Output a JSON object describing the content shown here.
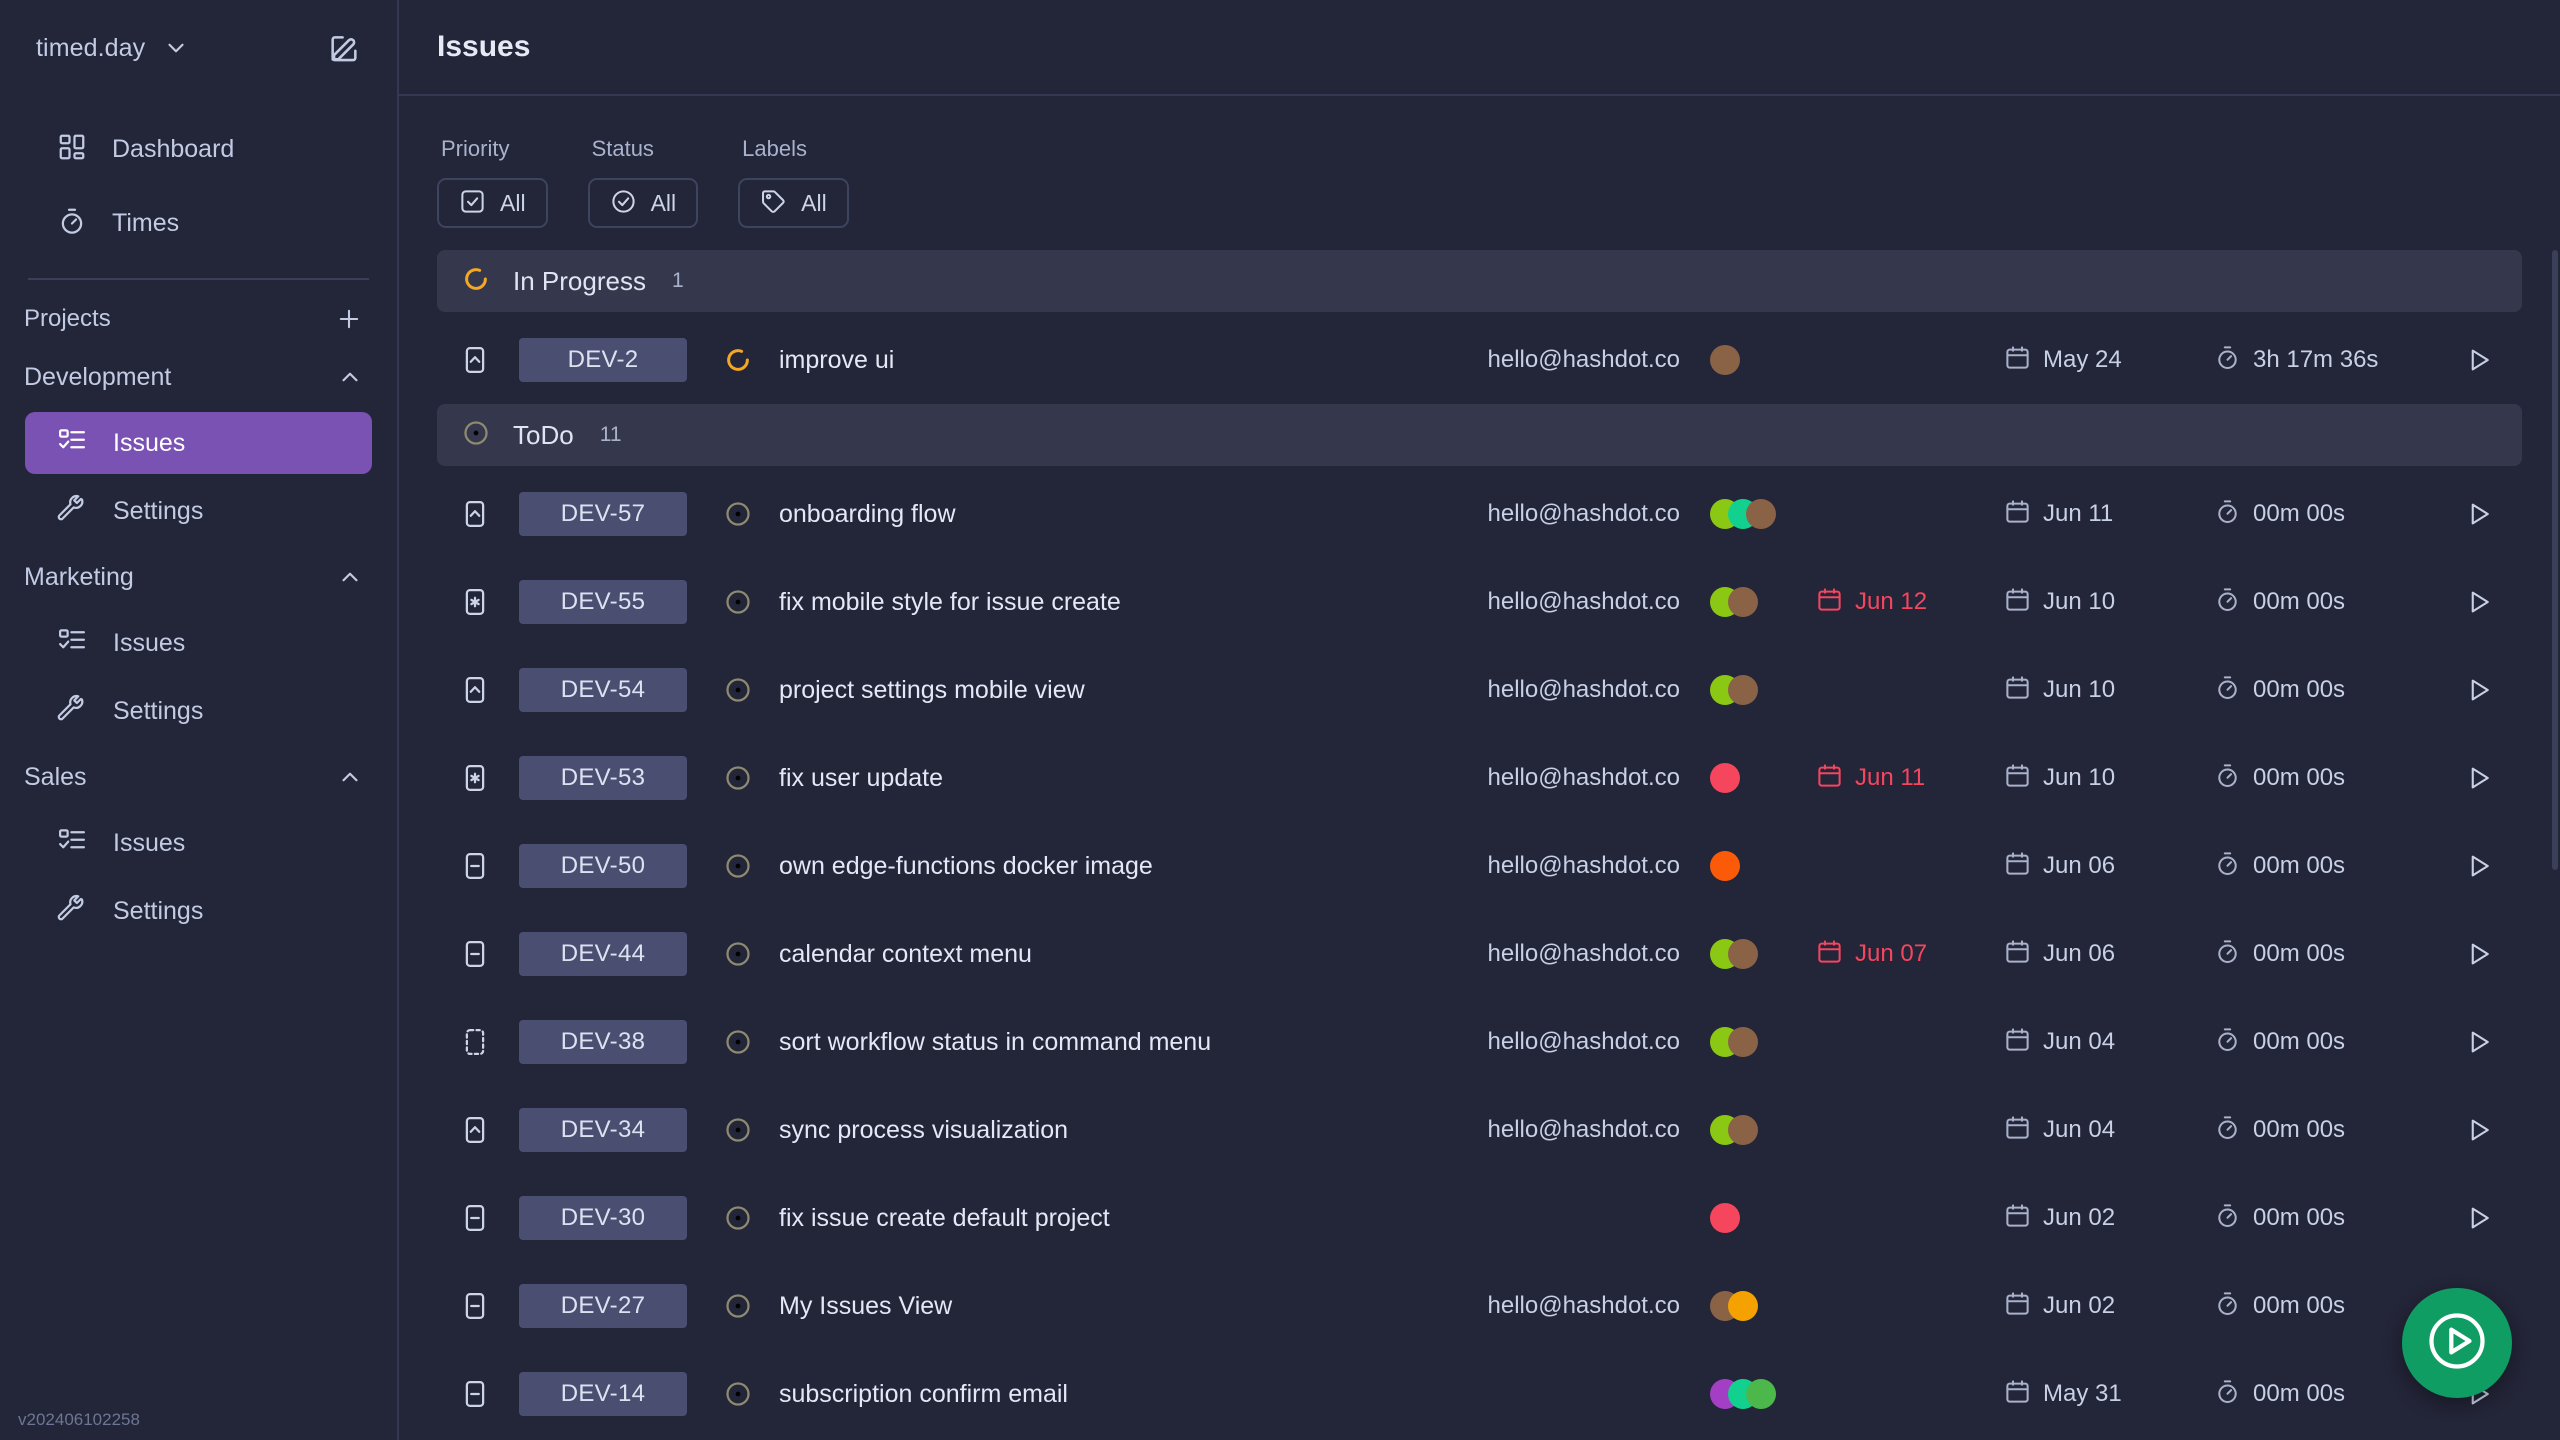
{
  "sidebar": {
    "workspace": "timed.day",
    "compose_icon": "compose-icon",
    "nav": [
      {
        "label": "Dashboard",
        "icon": "dashboard-icon"
      },
      {
        "label": "Times",
        "icon": "stopwatch-icon"
      }
    ],
    "projects_label": "Projects",
    "add_project_icon": "plus-icon",
    "groups": [
      {
        "name": "Development",
        "collapse_icon": "chevron-up-icon",
        "items": [
          {
            "label": "Issues",
            "icon": "issues-icon",
            "active": true
          },
          {
            "label": "Settings",
            "icon": "wrench-icon",
            "active": false
          }
        ]
      },
      {
        "name": "Marketing",
        "collapse_icon": "chevron-up-icon",
        "items": [
          {
            "label": "Issues",
            "icon": "issues-icon",
            "active": false
          },
          {
            "label": "Settings",
            "icon": "wrench-icon",
            "active": false
          }
        ]
      },
      {
        "name": "Sales",
        "collapse_icon": "chevron-up-icon",
        "items": [
          {
            "label": "Issues",
            "icon": "issues-icon",
            "active": false
          },
          {
            "label": "Settings",
            "icon": "wrench-icon",
            "active": false
          }
        ]
      }
    ],
    "version": "v202406102258"
  },
  "header": {
    "title": "Issues"
  },
  "filters": [
    {
      "label": "Priority",
      "value": "All",
      "icon": "checkbox-icon"
    },
    {
      "label": "Status",
      "value": "All",
      "icon": "check-circle-icon"
    },
    {
      "label": "Labels",
      "value": "All",
      "icon": "tag-icon"
    }
  ],
  "colors": {
    "accent_purple": "#7a52b3",
    "in_progress_orange": "#f5a623",
    "overdue_red": "#f5465d",
    "fab_green": "#0f9d64",
    "key_badge": "#4a4f72"
  },
  "groups": [
    {
      "name": "In Progress",
      "count": "1",
      "icon": "in-progress-icon",
      "rows": [
        {
          "priority": "high",
          "key": "DEV-2",
          "status_icon": "in-progress-icon",
          "title": "improve ui",
          "assignee": "hello@hashdot.co",
          "labels": [
            "#8a6246"
          ],
          "due": "",
          "due_overdue": false,
          "created": "May 24",
          "timer": "3h 17m 36s",
          "play_icon": "play-icon"
        }
      ]
    },
    {
      "name": "ToDo",
      "count": "11",
      "icon": "todo-icon",
      "rows": [
        {
          "priority": "high",
          "key": "DEV-57",
          "status_icon": "todo-icon",
          "title": "onboarding flow",
          "assignee": "hello@hashdot.co",
          "labels": [
            "#8bc814",
            "#12d18e",
            "#8a6246"
          ],
          "due": "",
          "due_overdue": false,
          "created": "Jun 11",
          "timer": "00m 00s",
          "play_icon": "play-icon"
        },
        {
          "priority": "urgent",
          "key": "DEV-55",
          "status_icon": "todo-icon",
          "title": "fix mobile style for issue create",
          "assignee": "hello@hashdot.co",
          "labels": [
            "#8bc814",
            "#8a6246"
          ],
          "due": "Jun 12",
          "due_overdue": true,
          "created": "Jun 10",
          "timer": "00m 00s",
          "play_icon": "play-icon"
        },
        {
          "priority": "high",
          "key": "DEV-54",
          "status_icon": "todo-icon",
          "title": "project settings mobile view",
          "assignee": "hello@hashdot.co",
          "labels": [
            "#8bc814",
            "#8a6246"
          ],
          "due": "",
          "due_overdue": false,
          "created": "Jun 10",
          "timer": "00m 00s",
          "play_icon": "play-icon"
        },
        {
          "priority": "urgent",
          "key": "DEV-53",
          "status_icon": "todo-icon",
          "title": "fix user update",
          "assignee": "hello@hashdot.co",
          "labels": [
            "#f5465d"
          ],
          "due": "Jun 11",
          "due_overdue": true,
          "created": "Jun 10",
          "timer": "00m 00s",
          "play_icon": "play-icon"
        },
        {
          "priority": "medium",
          "key": "DEV-50",
          "status_icon": "todo-icon",
          "title": "own edge-functions docker image",
          "assignee": "hello@hashdot.co",
          "labels": [
            "#fb5a09"
          ],
          "due": "",
          "due_overdue": false,
          "created": "Jun 06",
          "timer": "00m 00s",
          "play_icon": "play-icon"
        },
        {
          "priority": "medium",
          "key": "DEV-44",
          "status_icon": "todo-icon",
          "title": "calendar context menu",
          "assignee": "hello@hashdot.co",
          "labels": [
            "#8bc814",
            "#8a6246"
          ],
          "due": "Jun 07",
          "due_overdue": true,
          "created": "Jun 06",
          "timer": "00m 00s",
          "play_icon": "play-icon"
        },
        {
          "priority": "none",
          "key": "DEV-38",
          "status_icon": "todo-icon",
          "title": "sort workflow status in command menu",
          "assignee": "hello@hashdot.co",
          "labels": [
            "#8bc814",
            "#8a6246"
          ],
          "due": "",
          "due_overdue": false,
          "created": "Jun 04",
          "timer": "00m 00s",
          "play_icon": "play-icon"
        },
        {
          "priority": "high",
          "key": "DEV-34",
          "status_icon": "todo-icon",
          "title": "sync process visualization",
          "assignee": "hello@hashdot.co",
          "labels": [
            "#8bc814",
            "#8a6246"
          ],
          "due": "",
          "due_overdue": false,
          "created": "Jun 04",
          "timer": "00m 00s",
          "play_icon": "play-icon"
        },
        {
          "priority": "medium",
          "key": "DEV-30",
          "status_icon": "todo-icon",
          "title": "fix issue create default project",
          "assignee": "",
          "labels": [
            "#f5465d"
          ],
          "due": "",
          "due_overdue": false,
          "created": "Jun 02",
          "timer": "00m 00s",
          "play_icon": "play-icon"
        },
        {
          "priority": "medium",
          "key": "DEV-27",
          "status_icon": "todo-icon",
          "title": "My Issues View",
          "assignee": "hello@hashdot.co",
          "labels": [
            "#8a6246",
            "#f5a200"
          ],
          "due": "",
          "due_overdue": false,
          "created": "Jun 02",
          "timer": "00m 00s",
          "play_icon": "play-icon"
        },
        {
          "priority": "medium",
          "key": "DEV-14",
          "status_icon": "todo-icon",
          "title": "subscription confirm email",
          "assignee": "",
          "labels": [
            "#a23fc4",
            "#12d18e",
            "#4cb84c"
          ],
          "due": "",
          "due_overdue": false,
          "created": "May 31",
          "timer": "00m 00s",
          "play_icon": "play-icon"
        }
      ]
    }
  ],
  "fab": {
    "icon": "play-circle-icon"
  }
}
